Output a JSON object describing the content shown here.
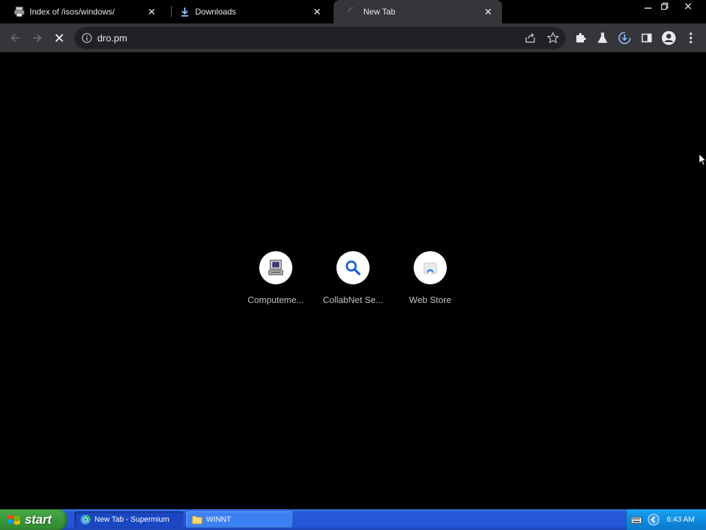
{
  "browser": {
    "tabs": [
      {
        "label": "Index of /isos/windows/",
        "icon": "printer-favicon-icon",
        "active": false
      },
      {
        "label": "Downloads",
        "icon": "download-icon",
        "active": false
      },
      {
        "label": "New Tab",
        "icon": "loading-spinner-icon",
        "active": true
      }
    ],
    "omnibox": {
      "url": "dro.pm"
    },
    "theme": {
      "accent": "#1a73e8",
      "toolbar": "#35363a",
      "omnibox": "#202124"
    }
  },
  "new_tab": {
    "shortcuts": [
      {
        "label": "Computeme...",
        "icon": "computer-icon"
      },
      {
        "label": "CollabNet Se...",
        "icon": "magnifier-icon"
      },
      {
        "label": "Web Store",
        "icon": "web-store-icon"
      }
    ]
  },
  "taskbar": {
    "start_label": "start",
    "items": [
      {
        "label": "New Tab - Supermium",
        "icon": "browser-icon"
      },
      {
        "label": "WINNT",
        "icon": "folder-icon"
      }
    ],
    "clock": "6:43 AM"
  }
}
